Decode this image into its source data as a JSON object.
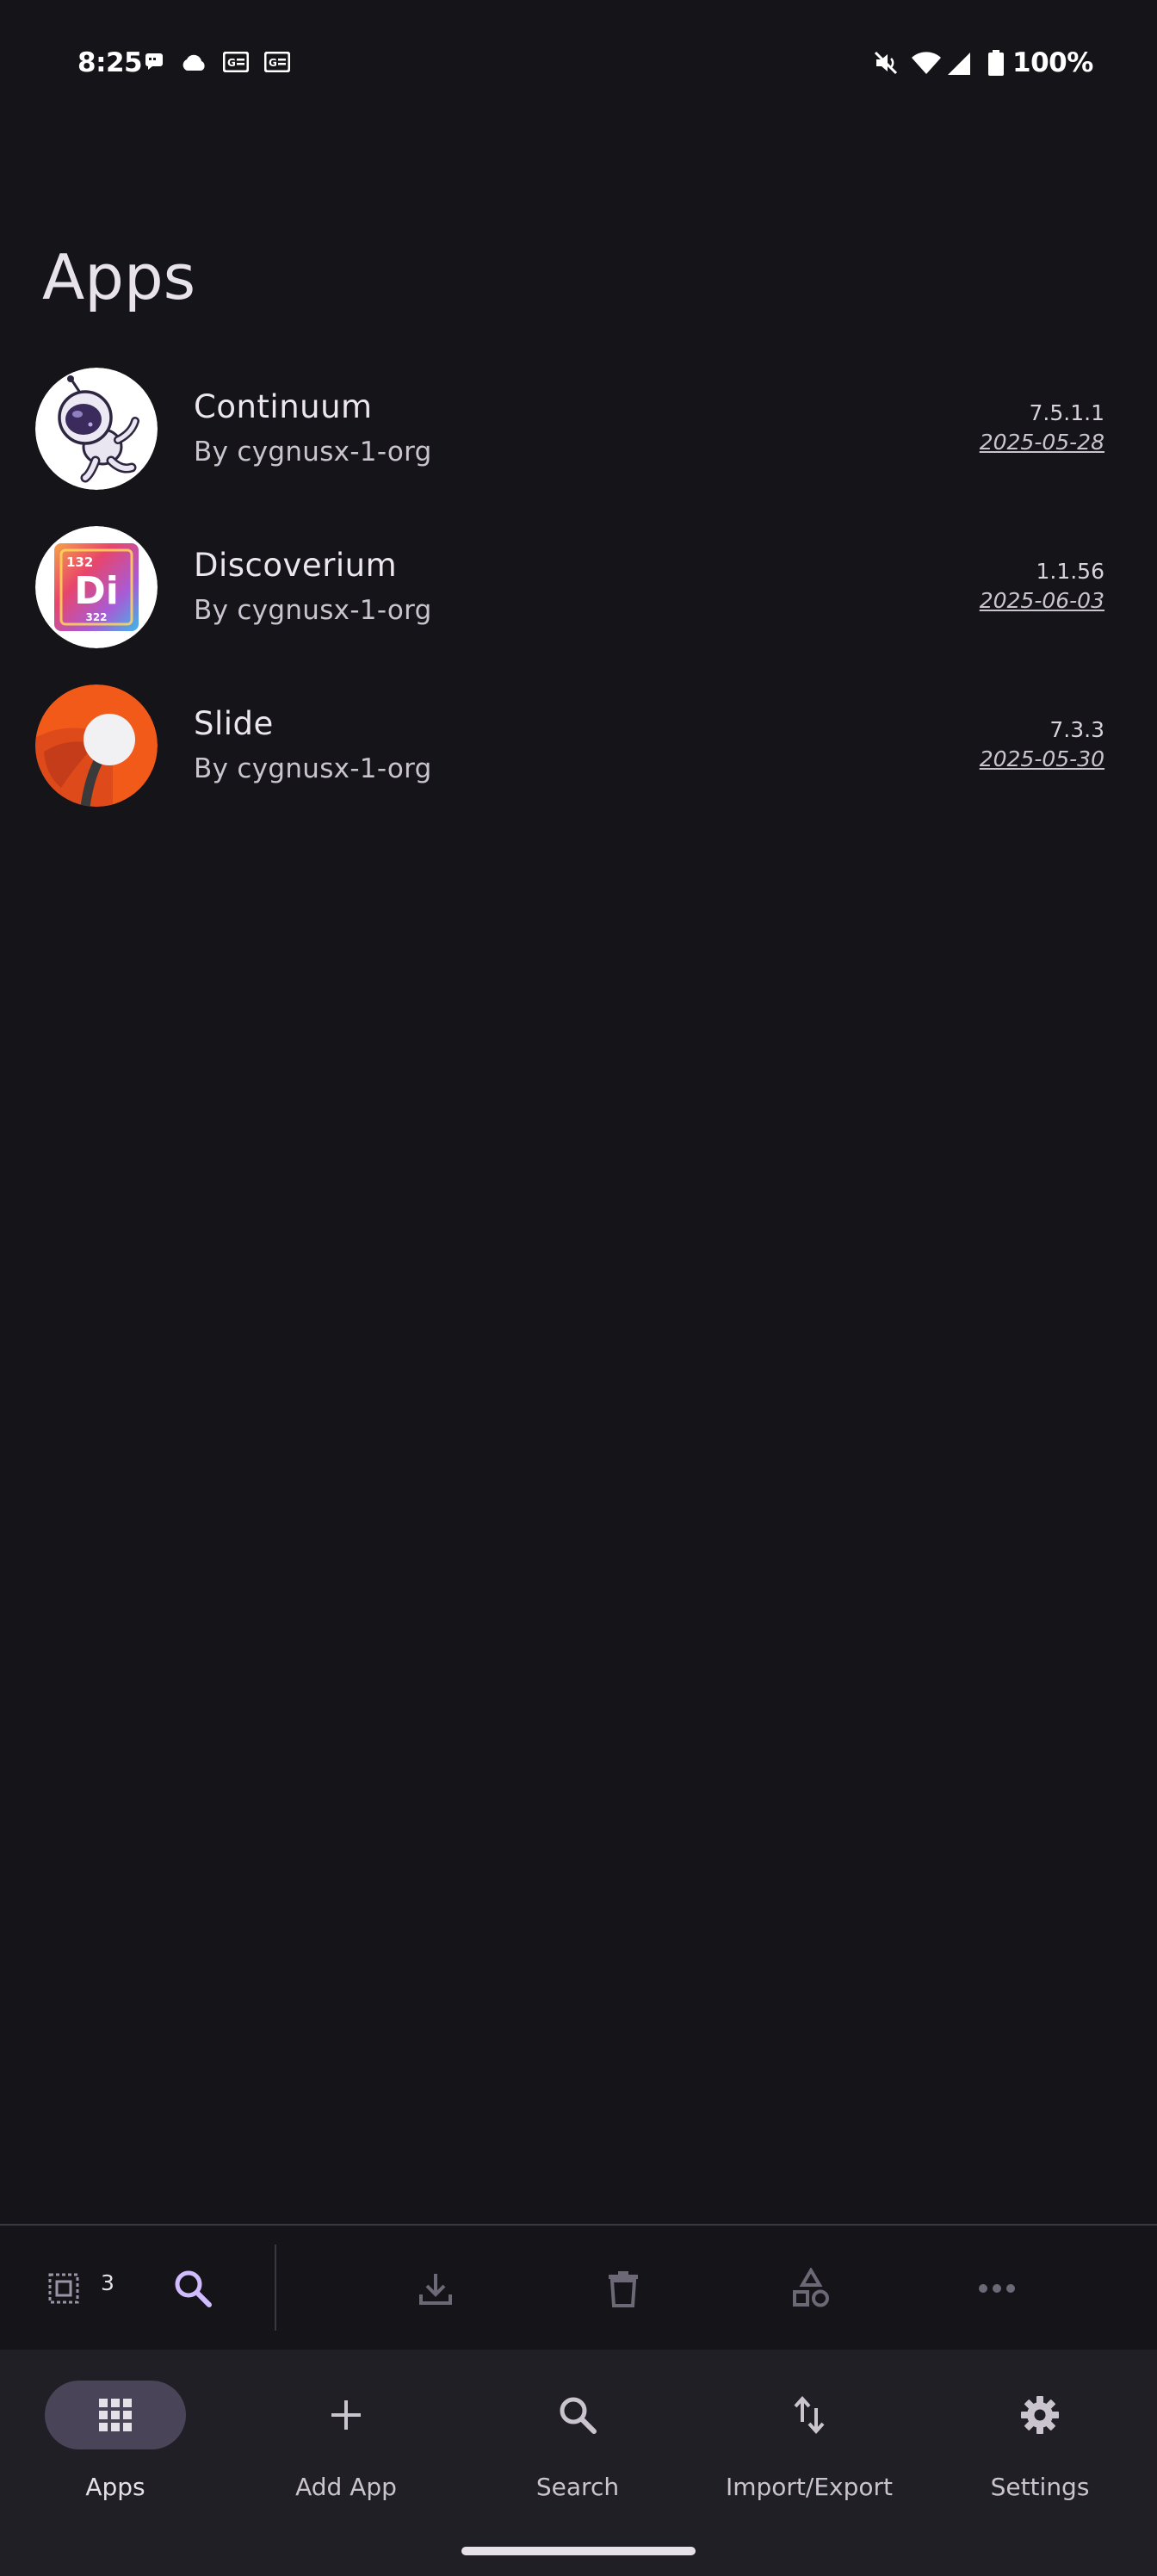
{
  "status_bar": {
    "time": "8:25",
    "battery": "100%",
    "icons_left": [
      "message-icon",
      "cloud-icon",
      "news-icon",
      "news-icon"
    ],
    "icons_right": [
      "mute-icon",
      "wifi-icon",
      "signal-icon",
      "battery-icon"
    ]
  },
  "page": {
    "title": "Apps"
  },
  "apps": [
    {
      "name": "Continuum",
      "author": "By cygnusx-1-org",
      "version": "7.5.1.1",
      "date": "2025-05-28",
      "icon": "astronaut-icon"
    },
    {
      "name": "Discoverium",
      "author": "By cygnusx-1-org",
      "version": "1.1.56",
      "date": "2025-06-03",
      "icon": "element-di-icon",
      "icon_text": {
        "top": "132",
        "main": "Di",
        "bottom": "322"
      }
    },
    {
      "name": "Slide",
      "author": "By cygnusx-1-org",
      "version": "7.3.3",
      "date": "2025-05-30",
      "icon": "slide-icon"
    }
  ],
  "action_bar": {
    "selected_count": "3",
    "actions": [
      "select-all-icon",
      "search-icon",
      "download-icon",
      "delete-icon",
      "categories-icon",
      "more-icon"
    ]
  },
  "nav": {
    "items": [
      {
        "label": "Apps",
        "icon": "apps-grid-icon",
        "active": true
      },
      {
        "label": "Add App",
        "icon": "plus-icon",
        "active": false
      },
      {
        "label": "Search",
        "icon": "search-icon",
        "active": false
      },
      {
        "label": "Import/Export",
        "icon": "import-export-icon",
        "active": false
      },
      {
        "label": "Settings",
        "icon": "gear-icon",
        "active": false
      }
    ]
  },
  "colors": {
    "background": "#151419",
    "nav_background": "#211f26",
    "active_pill": "#4a4458",
    "accent": "#d0bcff"
  }
}
